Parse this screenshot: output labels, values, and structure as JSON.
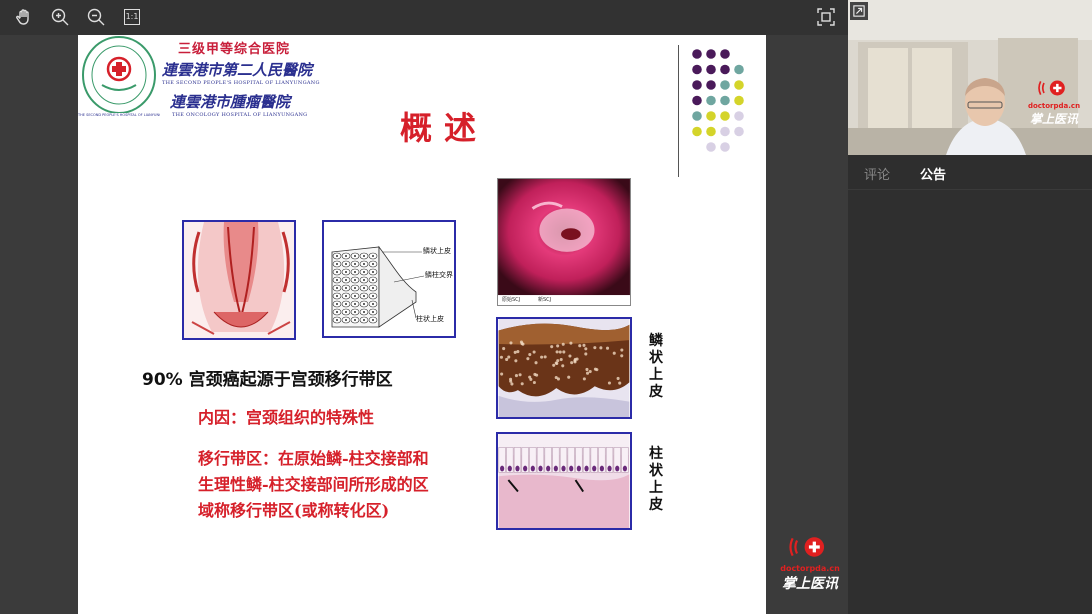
{
  "toolbar": {
    "hand_icon": "hand-icon",
    "zoom_in_icon": "zoom-in-icon",
    "zoom_out_icon": "zoom-out-icon",
    "actual_size_label": "1:1",
    "fullscreen_icon": "fullscreen-icon"
  },
  "slide": {
    "hospital_grade": "三级甲等综合医院",
    "hospital_name_2": "連雲港市第二人民醫院",
    "hospital_en_2": "THE SECOND PEOPLE'S HOSPITAL OF LIANYUNGANG",
    "hospital_name_3": "連雲港市腫瘤醫院",
    "hospital_en_3": "THE ONCOLOGY HOSPITAL OF LIANYUNGANG",
    "seal_text": "连云港市第二人民医院",
    "seal_en": "THE SECOND PEOPLE'S HOSPITAL OF LIANYUNGANG",
    "title": "概述",
    "diagram_labels": [
      "鳞状上皮",
      "鳞柱交界",
      "柱状上皮"
    ],
    "colpo_caption_left": "原始SCJ",
    "colpo_caption_right": "新SCJ",
    "main_statement": "90% 宫颈癌起源于宫颈移行带区",
    "cause_line": "内因：宫颈组织的特殊性",
    "definition_lines": [
      "移行带区：在原始鳞-柱交接部和",
      "生理性鳞-柱交接部间所形成的区",
      "域称移行带区(或称转化区)"
    ],
    "squamous_label": "鳞状上皮",
    "columnar_label": "柱状上皮",
    "watermark_domain": "doctorpda.cn",
    "watermark_brand": "掌上医讯"
  },
  "side": {
    "tabs": [
      {
        "label": "评论",
        "active": false
      },
      {
        "label": "公告",
        "active": true
      }
    ],
    "video_watermark_domain": "doctorpda.cn",
    "video_watermark_brand": "掌上医讯",
    "watermark_domain": "doctorpda.cn",
    "watermark_brand": "掌上医讯"
  },
  "colors": {
    "accent_red": "#d6202a",
    "hospital_blue": "#2a2f8f",
    "frame_blue": "#2b2ba8",
    "dot_purple": "#4a1a5a",
    "dot_teal": "#6fa6a0",
    "dot_yellow": "#d4d42a",
    "dot_lavender": "#d8d0e4"
  }
}
